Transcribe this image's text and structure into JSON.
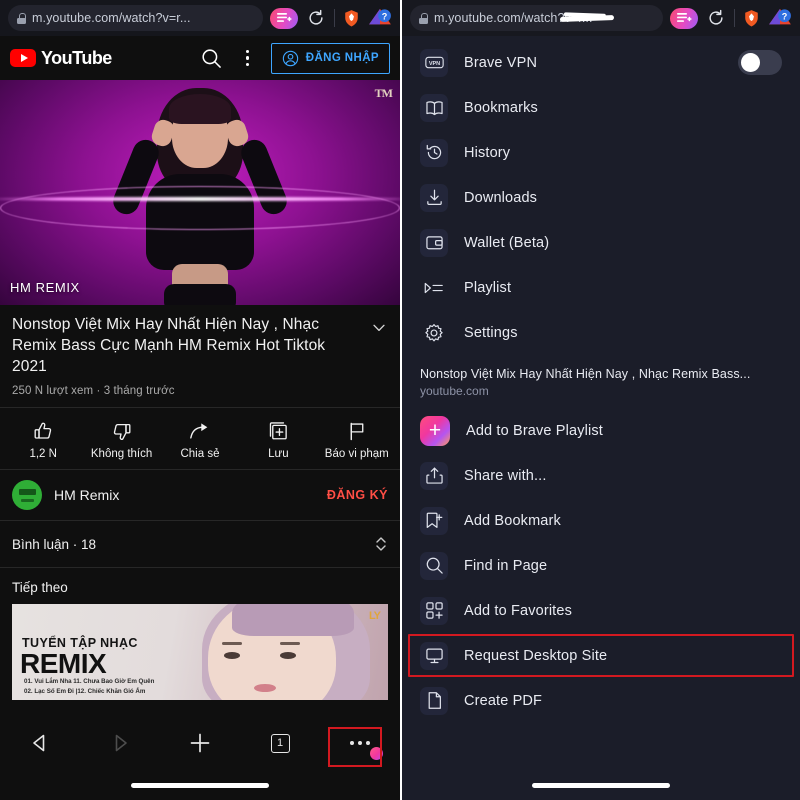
{
  "left_panel": {
    "browser": {
      "url": "m.youtube.com/watch?v=r...",
      "lock_icon": "lock-icon",
      "playlist_add_icon": "playlist-add-icon",
      "reload_icon": "reload-icon",
      "brave_shield_icon": "brave-lion-icon",
      "help_icon": "help-badge-icon"
    },
    "yt_header": {
      "logo_text": "YouTube",
      "search_icon": "search-icon",
      "kebab_icon": "more-vertical-icon",
      "signin_label": "ĐĂNG NHẬP",
      "signin_icon": "account-circle-icon"
    },
    "player": {
      "caption": "HM REMIX",
      "watermark": "TM"
    },
    "video": {
      "title": "Nonstop Việt Mix Hay Nhất Hiện Nay , Nhạc Remix Bass Cực Mạnh HM Remix Hot Tiktok 2021",
      "stats": "250 N lượt xem · 3 tháng trước",
      "expand_icon": "chevron-down-icon"
    },
    "actions": [
      {
        "label": "1,2 N",
        "icon": "thumb-up-icon"
      },
      {
        "label": "Không thích",
        "icon": "thumb-down-icon"
      },
      {
        "label": "Chia sẻ",
        "icon": "share-arrow-icon"
      },
      {
        "label": "Lưu",
        "icon": "save-plus-icon"
      },
      {
        "label": "Báo vi phạm",
        "icon": "flag-icon"
      }
    ],
    "channel": {
      "name": "HM Remix",
      "subscribe_label": "ĐĂNG KÝ",
      "avatar_icon": "channel-avatar"
    },
    "comments": {
      "label": "Bình luận · 18",
      "expand_icon": "expand-collapse-icon"
    },
    "next_up": {
      "heading": "Tiếp theo",
      "thumb_line1": "TUYỂN TẬP NHẠC",
      "thumb_line2": "REMIX",
      "thumb_tracks": "01. Vui Lắm Nha  11. Chưa Bao Giờ Em Quên\n02. Lạc Số Em Đi |12. Chiếc Khăn Gió Ấm",
      "thumb_logo": "LY"
    },
    "bottom_bar": {
      "back_icon": "back-arrow-icon",
      "forward_icon": "forward-arrow-icon",
      "new_tab_icon": "plus-icon",
      "tab_count": "1",
      "menu_icon": "more-horizontal-icon"
    }
  },
  "right_panel": {
    "browser": {
      "url": "m.youtube.com/watch?v=r...",
      "lock_icon": "lock-icon",
      "playlist_add_icon": "playlist-add-icon",
      "reload_icon": "reload-icon",
      "brave_shield_icon": "brave-lion-icon",
      "help_icon": "help-badge-icon"
    },
    "menu_top": [
      {
        "label": "Brave VPN",
        "icon": "vpn-icon",
        "toggle": "off"
      },
      {
        "label": "Bookmarks",
        "icon": "book-icon"
      },
      {
        "label": "History",
        "icon": "history-clock-icon"
      },
      {
        "label": "Downloads",
        "icon": "download-icon"
      },
      {
        "label": "Wallet (Beta)",
        "icon": "wallet-icon"
      },
      {
        "label": "Playlist",
        "icon": "playlist-icon"
      },
      {
        "label": "Settings",
        "icon": "gear-icon"
      }
    ],
    "context": {
      "page_title": "Nonstop Việt Mix Hay Nhất Hiện Nay , Nhạc Remix Bass...",
      "domain": "youtube.com"
    },
    "menu_bottom": [
      {
        "label": "Add to Brave Playlist",
        "icon": "brave-playlist-plus-icon",
        "highlighted": false
      },
      {
        "label": "Share with...",
        "icon": "share-icon",
        "highlighted": false
      },
      {
        "label": "Add Bookmark",
        "icon": "bookmark-plus-icon",
        "highlighted": false
      },
      {
        "label": "Find in Page",
        "icon": "search-icon",
        "highlighted": false
      },
      {
        "label": "Add to Favorites",
        "icon": "favorites-grid-icon",
        "highlighted": false
      },
      {
        "label": "Request Desktop Site",
        "icon": "desktop-monitor-icon",
        "highlighted": true
      },
      {
        "label": "Create PDF",
        "icon": "document-icon",
        "highlighted": false
      }
    ]
  },
  "colors": {
    "highlight_red": "#d31920",
    "youtube_red": "#ff0000",
    "signin_blue": "#3ea6ff",
    "subscribe_red": "#ff4e45",
    "brave_panel_bg": "#1b1d29",
    "yt_bg": "#0f0f0f"
  }
}
